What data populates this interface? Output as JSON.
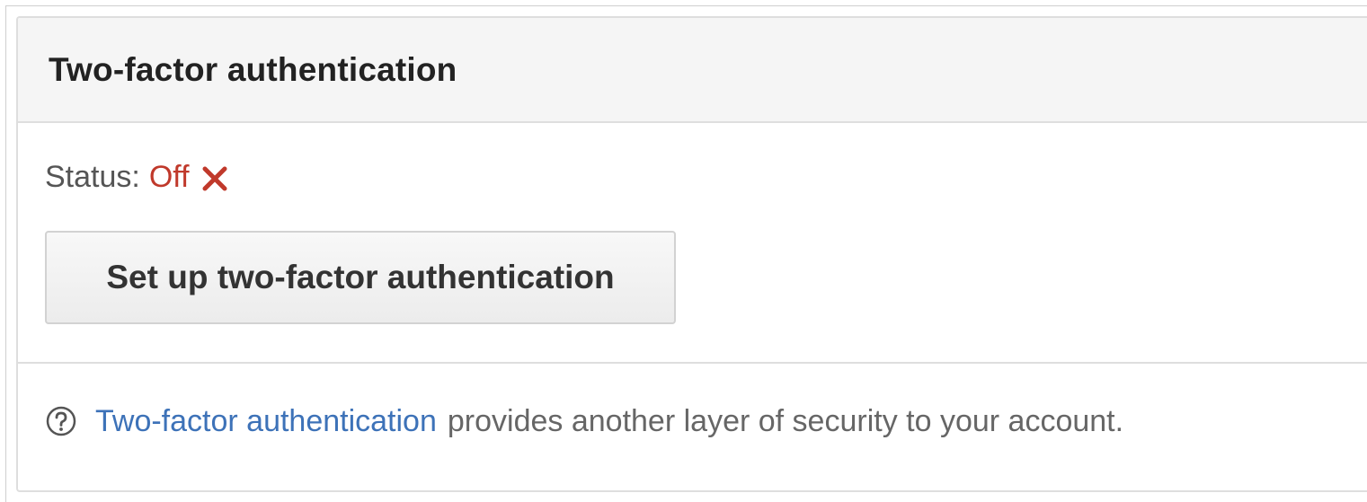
{
  "panel": {
    "title": "Two-factor authentication"
  },
  "status": {
    "label": "Status:",
    "value": "Off",
    "icon": "close-x-icon",
    "value_color": "#c0392b"
  },
  "setup_button": {
    "label": "Set up two-factor authentication"
  },
  "help": {
    "icon": "question-circle-icon",
    "link_text": "Two-factor authentication",
    "text": "provides another layer of security to your account.",
    "link_color": "#3d72b8"
  }
}
